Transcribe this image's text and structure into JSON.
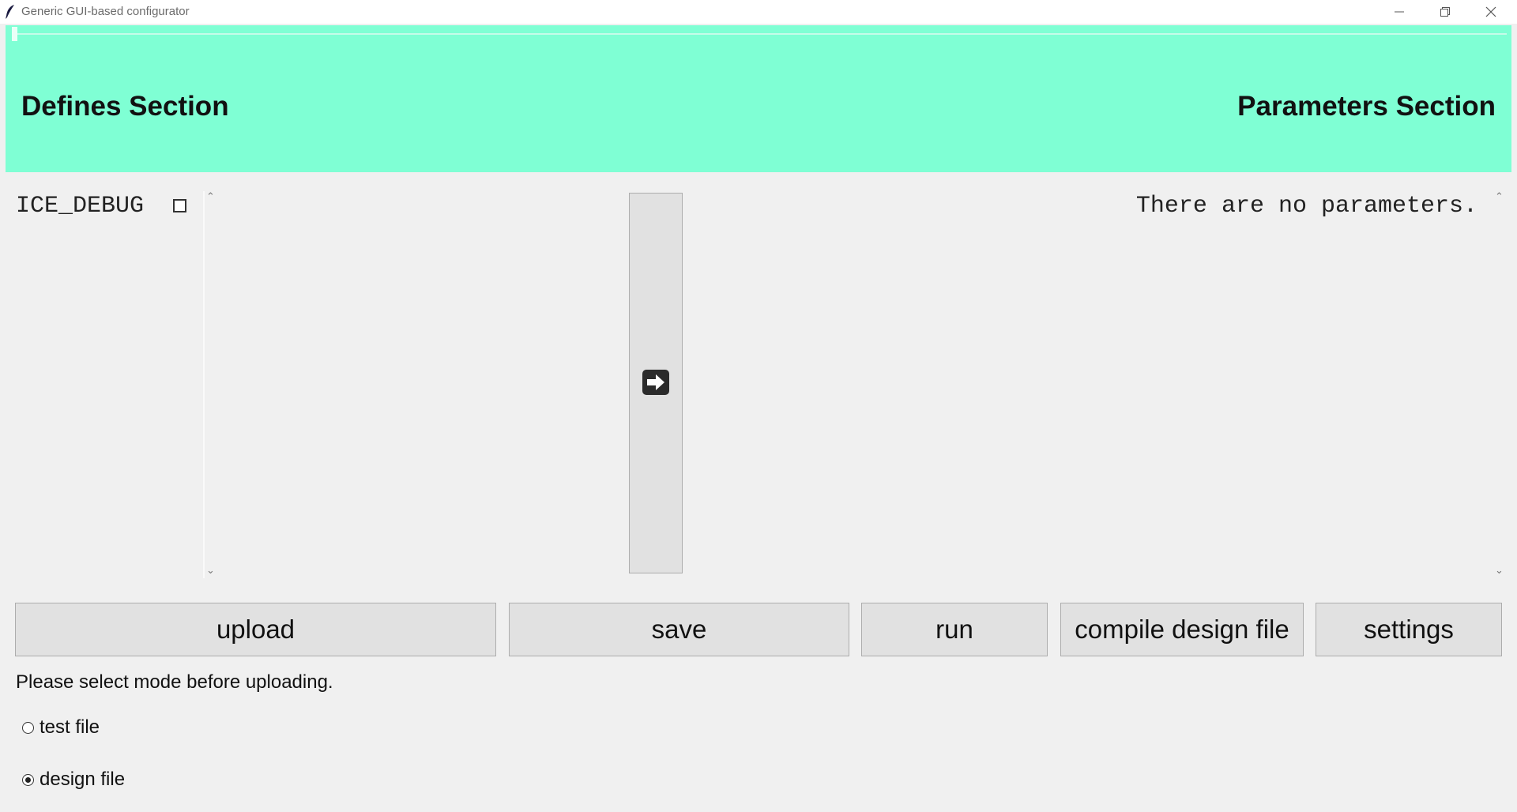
{
  "window": {
    "title": "Generic GUI-based configurator",
    "controls": [
      "minimize-icon",
      "maximize-icon",
      "close-icon"
    ]
  },
  "header": {
    "background": "#7fffd4",
    "defines_title": "Defines Section",
    "parameters_title": "Parameters Section"
  },
  "defines": {
    "items": [
      {
        "label": "ICE_DEBUG",
        "checked": false
      }
    ]
  },
  "transfer_button": {
    "icon": "arrow-right-icon"
  },
  "parameters": {
    "empty_message": "There are no parameters."
  },
  "toolbar": {
    "upload_label": "upload",
    "save_label": "save",
    "run_label": "run",
    "compile_label": "compile design file",
    "settings_label": "settings"
  },
  "status": {
    "message": "Please select mode before uploading."
  },
  "mode": {
    "options": [
      {
        "label": "test file",
        "selected": false
      },
      {
        "label": "design file",
        "selected": true
      }
    ]
  }
}
